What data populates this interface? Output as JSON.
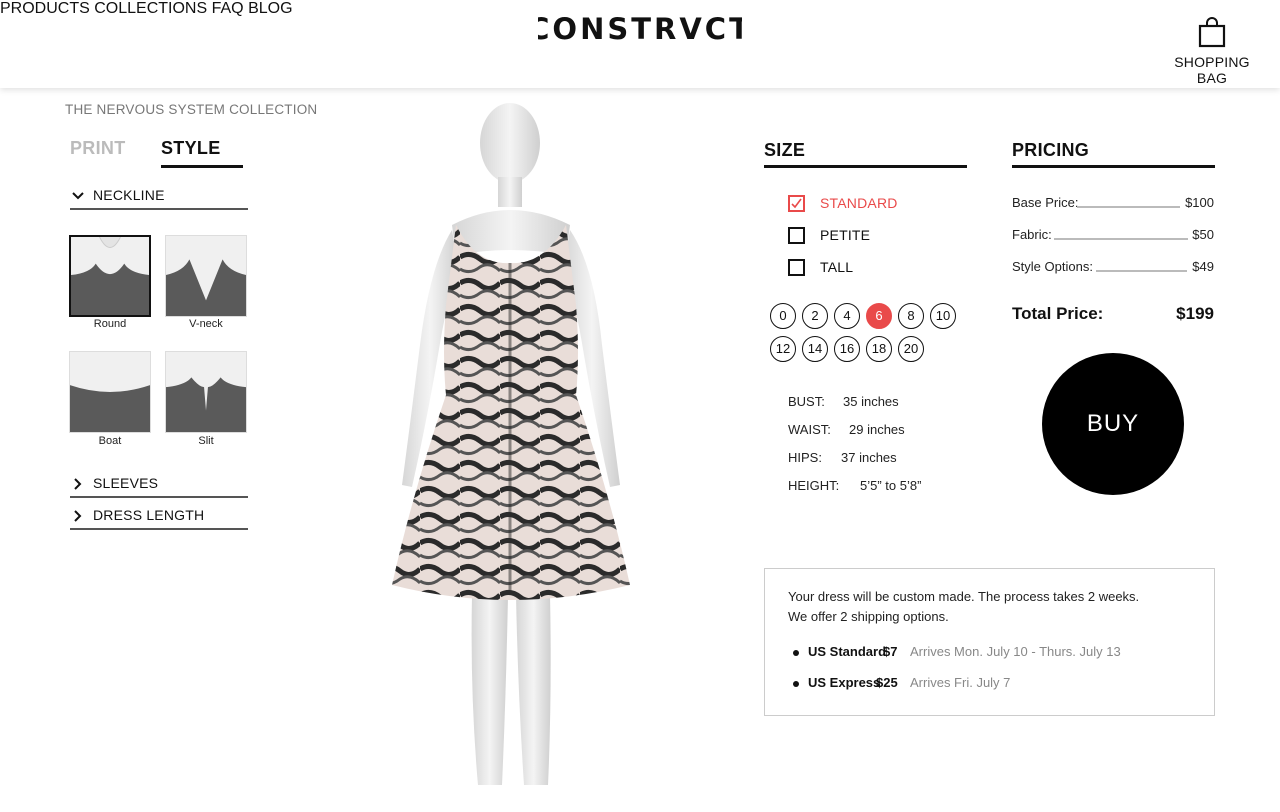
{
  "header": {
    "logo_text": "CONSTRVCT",
    "nav": [
      "PRODUCTS",
      "COLLECTIONS",
      "FAQ",
      "BLOG"
    ],
    "bag_label": "SHOPPING BAG",
    "bag_icon": "shopping-bag-icon"
  },
  "left": {
    "collection": "THE NERVOUS SYSTEM COLLECTION",
    "tabs": {
      "print": "PRINT",
      "style": "STYLE"
    },
    "neckline_label": "NECKLINE",
    "necklines": [
      {
        "label": "Round",
        "selected": true
      },
      {
        "label": "V-neck",
        "selected": false
      },
      {
        "label": "Boat",
        "selected": false
      },
      {
        "label": "Slit",
        "selected": false
      }
    ],
    "sleeves_label": "SLEEVES",
    "length_label": "DRESS LENGTH"
  },
  "size": {
    "title": "SIZE",
    "fits": [
      {
        "label": "STANDARD",
        "checked": true
      },
      {
        "label": "PETITE",
        "checked": false
      },
      {
        "label": "TALL",
        "checked": false
      }
    ],
    "sizes": [
      "0",
      "2",
      "4",
      "6",
      "8",
      "10",
      "12",
      "14",
      "16",
      "18",
      "20"
    ],
    "selected_size": "6",
    "measurements": {
      "bust_label": "BUST:",
      "bust_value": "35 inches",
      "waist_label": "WAIST:",
      "waist_value": "29 inches",
      "hips_label": "HIPS:",
      "hips_value": "37 inches",
      "height_label": "HEIGHT:",
      "height_value": "5’5” to 5’8”"
    }
  },
  "pricing": {
    "title": "PRICING",
    "base_label": "Base Price:",
    "base_value": "$100",
    "fabric_label": "Fabric:",
    "fabric_value": "$50",
    "style_label": "Style Options:",
    "style_value": "$49",
    "total_label": "Total Price:",
    "total_value": "$199",
    "buy_label": "BUY"
  },
  "shipping": {
    "line1": "Your dress will be custom made. The process takes 2 weeks.",
    "line2": "We offer 2 shipping options.",
    "options": [
      {
        "name": "US Standard",
        "cost": "$7",
        "arrival": "Arrives Mon. July 10 - Thurs. July 13"
      },
      {
        "name": "US Express",
        "cost": "$25",
        "arrival": "Arrives Fri. July 7"
      }
    ]
  },
  "colors": {
    "accent": "#e94a4a",
    "text": "#111111",
    "muted": "#888888"
  }
}
